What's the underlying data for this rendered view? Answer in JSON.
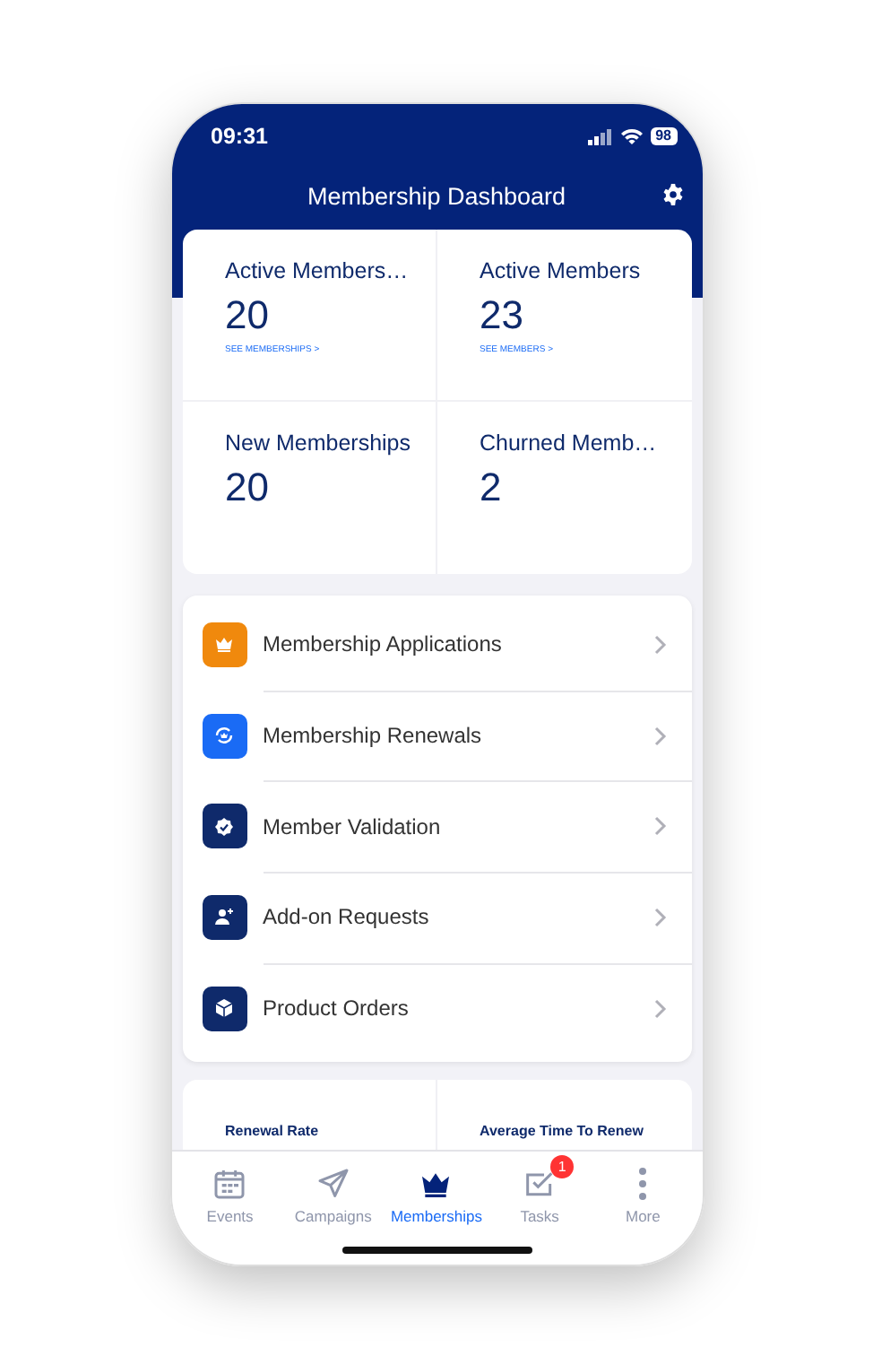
{
  "status_bar": {
    "time": "09:31",
    "battery": "98"
  },
  "header": {
    "title": "Membership Dashboard"
  },
  "stats": [
    {
      "label": "Active Members…",
      "value": "20",
      "link": "SEE MEMBERSHIPS >"
    },
    {
      "label": "Active Members",
      "value": "23",
      "link": "SEE MEMBERS >"
    },
    {
      "label": "New Memberships",
      "value": "20"
    },
    {
      "label": "Churned Memb…",
      "value": "2"
    }
  ],
  "menu": [
    {
      "label": "Membership Applications",
      "kind": "crown",
      "color": "#f0890d"
    },
    {
      "label": "Membership Renewals",
      "kind": "renew",
      "color": "#1a6bf5"
    },
    {
      "label": "Member Validation",
      "kind": "check",
      "color": "#0f2a6b"
    },
    {
      "label": "Add-on Requests",
      "kind": "person",
      "color": "#0f2a6b"
    },
    {
      "label": "Product Orders",
      "kind": "box",
      "color": "#0f2a6b"
    }
  ],
  "metrics": [
    {
      "label": "Renewal Rate"
    },
    {
      "label": "Average Time To Renew"
    }
  ],
  "tabs": [
    {
      "label": "Events",
      "kind": "calendar",
      "selected": false
    },
    {
      "label": "Campaigns",
      "kind": "plane",
      "selected": false
    },
    {
      "label": "Memberships",
      "kind": "crown",
      "selected": true
    },
    {
      "label": "Tasks",
      "kind": "tasks",
      "selected": false,
      "badge": "1"
    },
    {
      "label": "More",
      "kind": "dots",
      "selected": false
    }
  ]
}
